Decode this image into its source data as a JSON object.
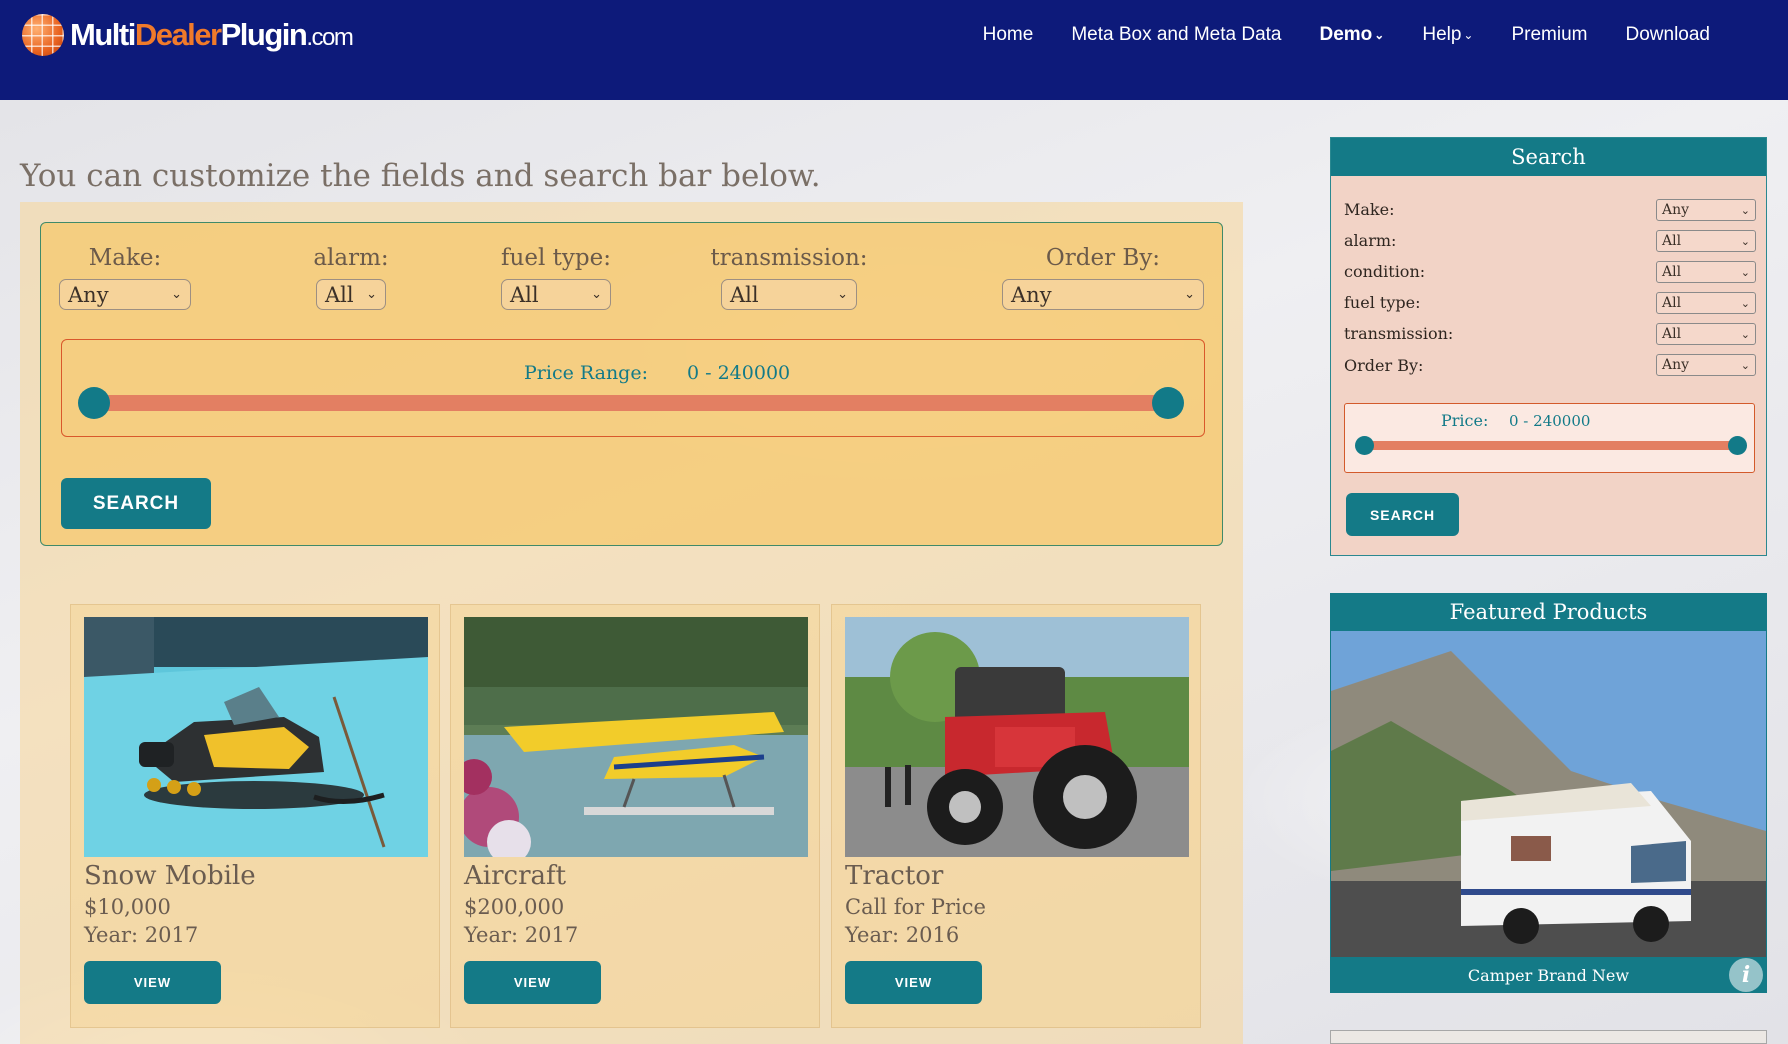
{
  "header": {
    "logo": {
      "part1": "Multi",
      "part2": "Dealer",
      "part3": "Plugin",
      "part4": ".com"
    },
    "nav": [
      {
        "label": "Home"
      },
      {
        "label": "Meta Box and Meta Data"
      },
      {
        "label": "Demo",
        "active": true
      },
      {
        "label": "Help"
      },
      {
        "label": "Premium"
      },
      {
        "label": "Download"
      }
    ]
  },
  "main": {
    "intro": "You can customize the fields and search bar below.",
    "search": {
      "fields": [
        {
          "label": "Make:",
          "value": "Any"
        },
        {
          "label": "alarm:",
          "value": "All"
        },
        {
          "label": "fuel type:",
          "value": "All"
        },
        {
          "label": "transmission:",
          "value": "All"
        },
        {
          "label": "Order By:",
          "value": "Any"
        }
      ],
      "price_label": "Price Range:",
      "price_value": "0 - 240000",
      "price_range": {
        "min": 0,
        "max": 240000
      },
      "button": "SEARCH"
    },
    "products": [
      {
        "title": "Snow Mobile",
        "price": "$10,000",
        "year": "Year: 2017",
        "button": "VIEW"
      },
      {
        "title": "Aircraft",
        "price": "$200,000",
        "year": "Year: 2017",
        "button": "VIEW"
      },
      {
        "title": "Tractor",
        "price": "Call for Price",
        "year": "Year: 2016",
        "button": "VIEW"
      }
    ]
  },
  "sidebar": {
    "search": {
      "title": "Search",
      "rows": [
        {
          "label": "Make:",
          "value": "Any"
        },
        {
          "label": "alarm:",
          "value": "All"
        },
        {
          "label": "condition:",
          "value": "All"
        },
        {
          "label": "fuel type:",
          "value": "All"
        },
        {
          "label": "transmission:",
          "value": "All"
        },
        {
          "label": "Order By:",
          "value": "Any"
        }
      ],
      "price_label": "Price:",
      "price_value": "0 - 240000",
      "button": "SEARCH"
    },
    "featured": {
      "title": "Featured Products",
      "caption": "Camper Brand New"
    }
  },
  "colors": {
    "header_bg": "#0d1a7a",
    "accent_teal": "#147a87",
    "accent_orange": "#e37f62"
  }
}
